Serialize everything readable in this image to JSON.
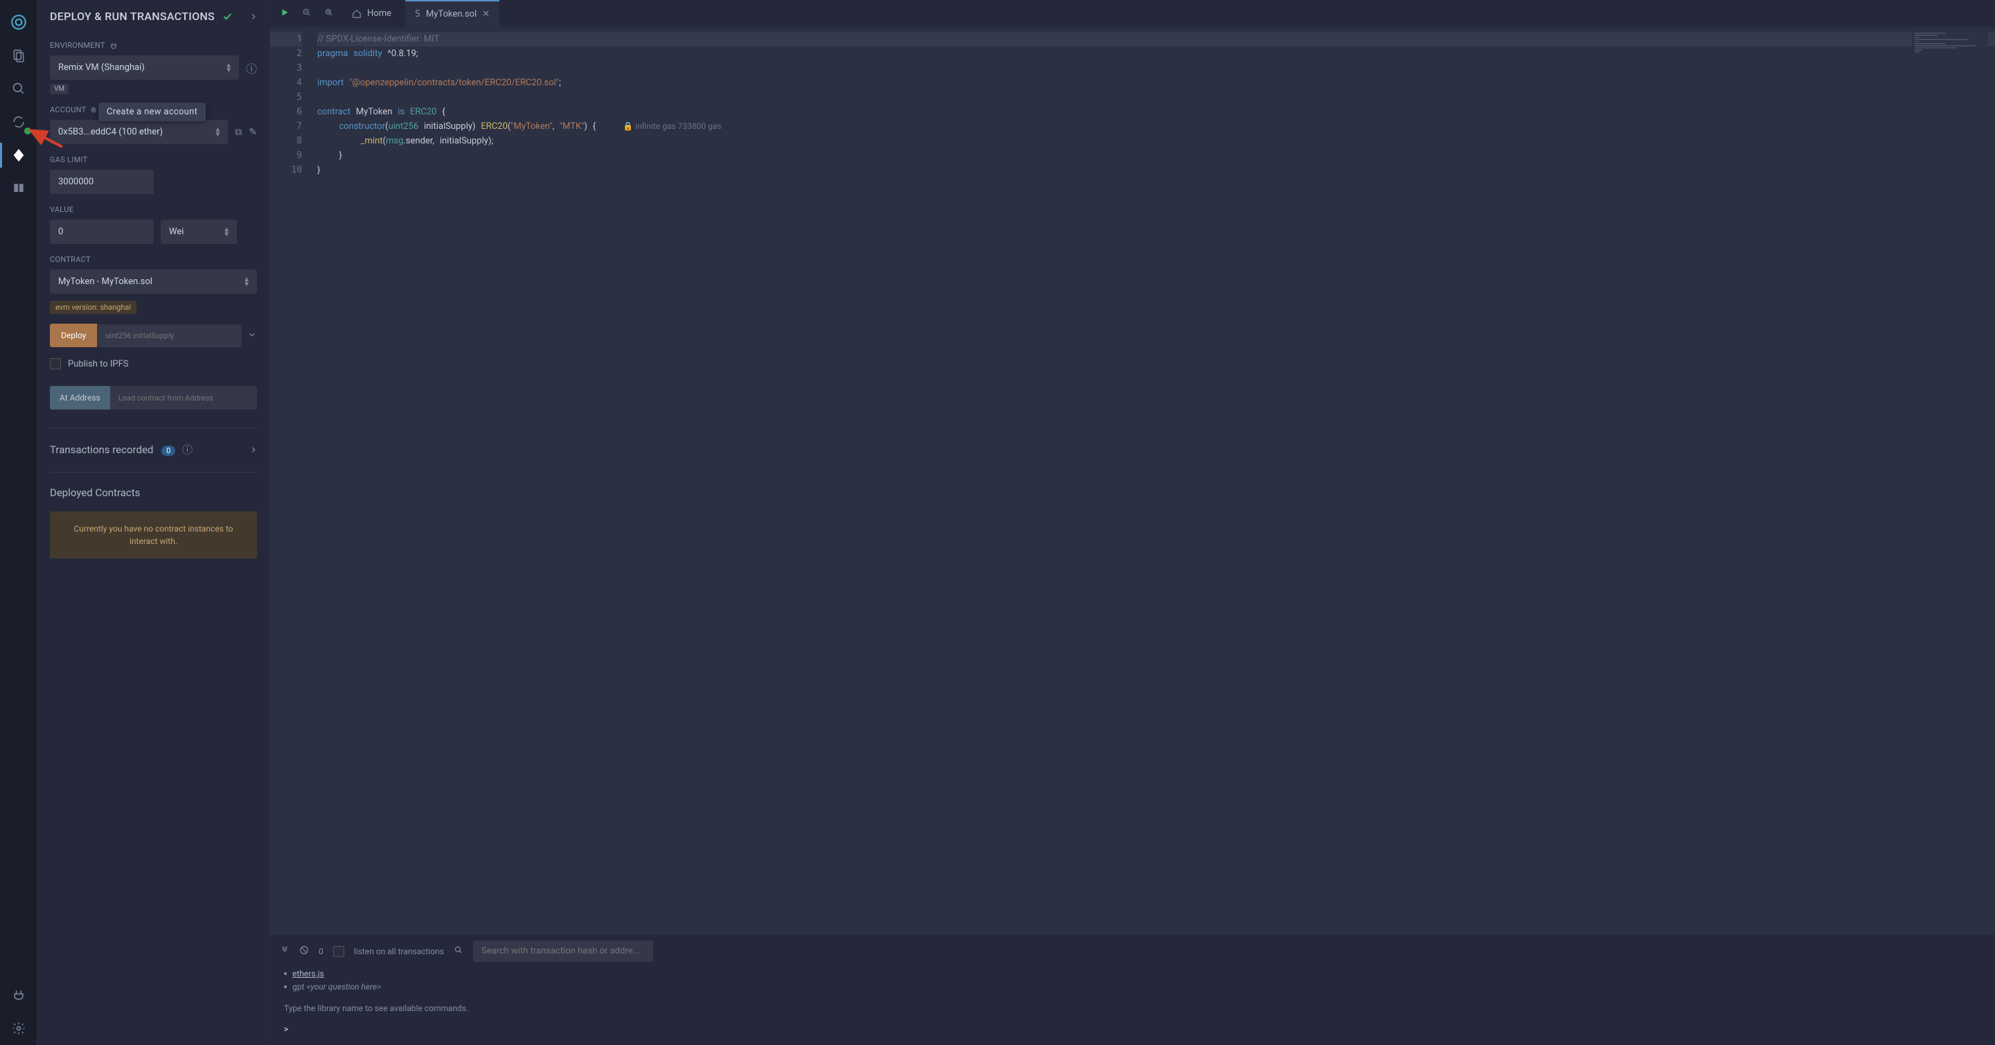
{
  "panel": {
    "title": "DEPLOY & RUN TRANSACTIONS",
    "env_label": "ENVIRONMENT",
    "env_value": "Remix VM (Shanghai)",
    "vm_badge": "VM",
    "account_label": "ACCOUNT",
    "account_value": "0x5B3...eddC4 (100 ether)",
    "account_tooltip": "Create a new account",
    "gas_label": "GAS LIMIT",
    "gas_value": "3000000",
    "value_label": "VALUE",
    "value_amount": "0",
    "value_unit": "Wei",
    "contract_label": "CONTRACT",
    "contract_value": "MyToken - MyToken.sol",
    "evm_badge": "evm version: shanghai",
    "deploy_btn": "Deploy",
    "deploy_placeholder": "uint256 initialSupply",
    "publish_ipfs": "Publish to IPFS",
    "at_address_btn": "At Address",
    "at_address_placeholder": "Load contract from Address",
    "transactions_label": "Transactions recorded",
    "transactions_count": "0",
    "deployed_label": "Deployed Contracts",
    "no_contract_msg": "Currently you have no contract instances to interact with."
  },
  "tabs": {
    "home": "Home",
    "file": "MyToken.sol"
  },
  "editor": {
    "lines": [
      "1",
      "2",
      "3",
      "4",
      "5",
      "6",
      "7",
      "8",
      "9",
      "10"
    ],
    "l1": "// SPDX-License-Identifier: MIT",
    "l2a": "pragma",
    "l2b": "solidity",
    "l2c": "^0.8.19;",
    "l4a": "import",
    "l4b": "\"@openzeppelin/contracts/token/ERC20/ERC20.sol\"",
    "l4c": ";",
    "l6a": "contract",
    "l6b": "MyToken",
    "l6c": "is",
    "l6d": "ERC20",
    "l6e": "{",
    "l7a": "constructor",
    "l7b": "(",
    "l7c": "uint256",
    "l7d": "initialSupply",
    "l7e": ")",
    "l7f": "ERC20",
    "l7g": "(",
    "l7h": "\"MyToken\"",
    "l7i": ",",
    "l7j": "\"MTK\"",
    "l7k": ")",
    "l7l": "{",
    "l7gas": "🔒 infinite gas 733800 gas",
    "l8a": "_mint",
    "l8b": "(",
    "l8c": "msg",
    "l8d": ".sender,",
    "l8e": "initialSupply",
    "l8f": ");",
    "l9": "}",
    "l10": "}"
  },
  "terminal": {
    "count": "0",
    "listen": "listen on all transactions",
    "search_placeholder": "Search with transaction hash or addre...",
    "ethers": "ethers.js",
    "gpt_pre": "gpt ",
    "gpt_hint": "<your question here>",
    "hint": "Type the library name to see available commands.",
    "prompt": ">"
  }
}
